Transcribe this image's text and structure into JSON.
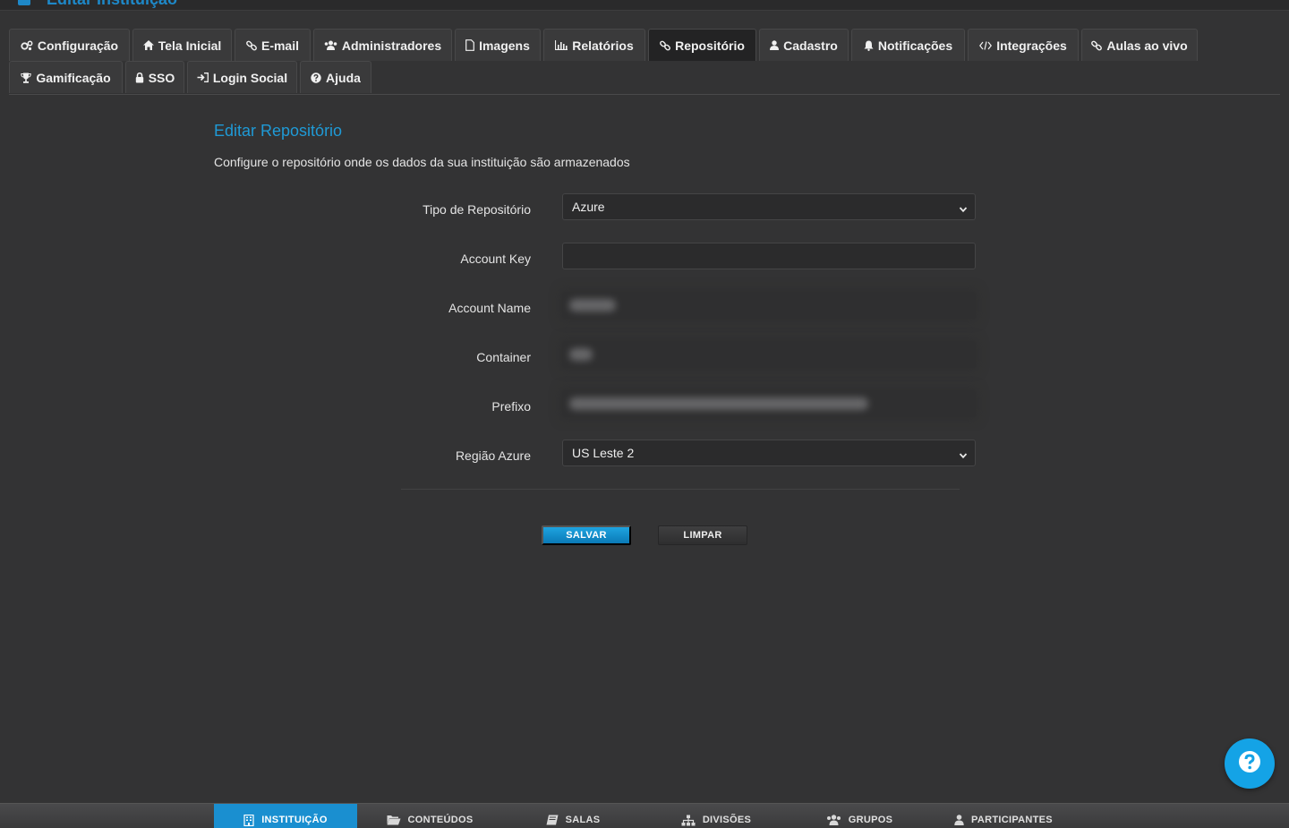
{
  "header": {
    "title": "Editar Instituição"
  },
  "tabs": [
    {
      "label": "Configuração",
      "icon": "gears-icon"
    },
    {
      "label": "Tela Inicial",
      "icon": "home-icon"
    },
    {
      "label": "E-mail",
      "icon": "link-icon"
    },
    {
      "label": "Administradores",
      "icon": "users-icon"
    },
    {
      "label": "Imagens",
      "icon": "file-icon"
    },
    {
      "label": "Relatórios",
      "icon": "bar-chart-icon"
    },
    {
      "label": "Repositório",
      "icon": "link-icon"
    },
    {
      "label": "Cadastro",
      "icon": "user-icon"
    },
    {
      "label": "Notificações",
      "icon": "bell-icon"
    },
    {
      "label": "Integrações",
      "icon": "code-icon"
    },
    {
      "label": "Aulas ao vivo",
      "icon": "link-icon"
    },
    {
      "label": "Gamificação",
      "icon": "trophy-icon"
    },
    {
      "label": "SSO",
      "icon": "lock-icon"
    },
    {
      "label": "Login Social",
      "icon": "sign-in-icon"
    },
    {
      "label": "Ajuda",
      "icon": "question-circle-icon"
    }
  ],
  "active_tab": "Repositório",
  "form": {
    "title": "Editar Repositório",
    "description": "Configure o repositório onde os dados da sua instituição são armazenados",
    "fields": {
      "repo_type": {
        "label": "Tipo de Repositório",
        "value": "Azure"
      },
      "account_key": {
        "label": "Account Key",
        "value": ""
      },
      "account_name": {
        "label": "Account Name"
      },
      "container": {
        "label": "Container"
      },
      "prefix": {
        "label": "Prefixo"
      },
      "azure_region": {
        "label": "Região Azure",
        "value": "US Leste 2"
      }
    },
    "save_label": "SALVAR",
    "clear_label": "LIMPAR"
  },
  "bottom_nav": [
    {
      "label": "INSTITUIÇÃO",
      "icon": "building-icon",
      "active": true
    },
    {
      "label": "CONTEÚDOS",
      "icon": "folder-open-icon",
      "active": false
    },
    {
      "label": "SALAS",
      "icon": "book-icon",
      "active": false
    },
    {
      "label": "DIVISÕES",
      "icon": "sitemap-icon",
      "active": false
    },
    {
      "label": "GRUPOS",
      "icon": "users-icon",
      "active": false
    },
    {
      "label": "PARTICIPANTES",
      "icon": "user-icon",
      "active": false
    }
  ],
  "colors": {
    "accent": "#1f9ad6",
    "background": "#333334",
    "active_tab": "#232324",
    "save_button": "#1a8fd0"
  }
}
